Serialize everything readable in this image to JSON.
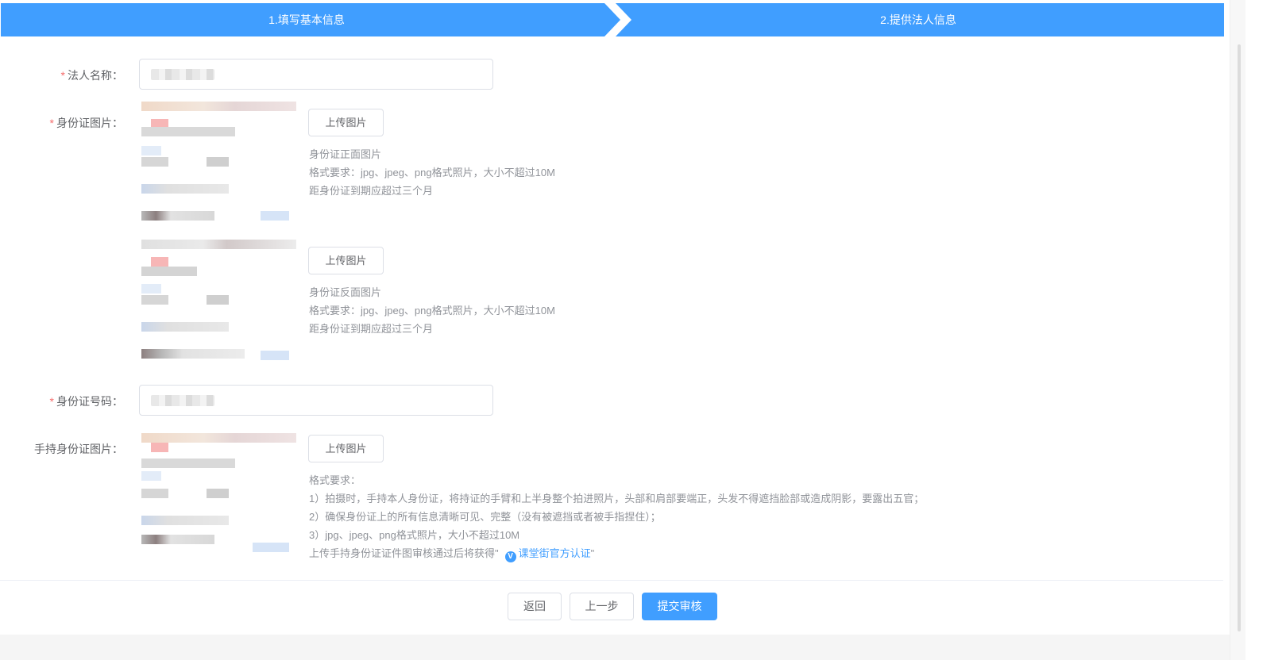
{
  "steps": [
    {
      "label": "1.填写基本信息"
    },
    {
      "label": "2.提供法人信息"
    }
  ],
  "form": {
    "legal_name": {
      "required_mark": "*",
      "label": "法人名称："
    },
    "id_photos": {
      "required_mark": "*",
      "label": "身份证图片：",
      "front": {
        "upload_label": "上传图片",
        "hints": [
          "身份证正面图片",
          "格式要求：jpg、jpeg、png格式照片，大小不超过10M",
          "距身份证到期应超过三个月"
        ]
      },
      "back": {
        "upload_label": "上传图片",
        "hints": [
          "身份证反面图片",
          "格式要求：jpg、jpeg、png格式照片，大小不超过10M",
          "距身份证到期应超过三个月"
        ]
      }
    },
    "id_number": {
      "required_mark": "*",
      "label": "身份证号码："
    },
    "handheld": {
      "label": "手持身份证图片：",
      "upload_label": "上传图片",
      "hints": [
        "格式要求：",
        "1）拍摄时，手持本人身份证，将持证的手臂和上半身整个拍进照片，头部和肩部要端正，头发不得遮挡脸部或造成阴影，要露出五官；",
        "2）确保身份证上的所有信息清晰可见、完整（没有被遮挡或者被手指捏住）；",
        "3）jpg、jpeg、png格式照片，大小不超过10M"
      ],
      "cert_prefix": "上传手持身份证证件图审核通过后将获得\"",
      "cert_badge": "V",
      "cert_link": "课堂街官方认证",
      "cert_suffix": "\""
    }
  },
  "footer": {
    "back_label": "返回",
    "prev_label": "上一步",
    "submit_label": "提交审核"
  },
  "colors": {
    "primary": "#409eff",
    "required": "#f56c6c",
    "hint": "#909399"
  }
}
